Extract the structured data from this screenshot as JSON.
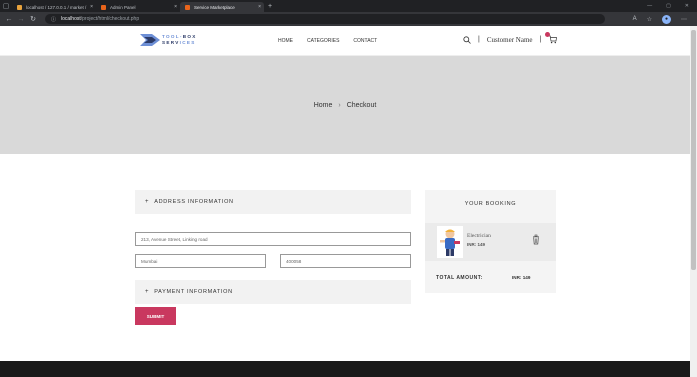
{
  "browser": {
    "tabs": [
      {
        "label": "localhost / 127.0.0.1 / market /",
        "favicon_color": "#e8a33d"
      },
      {
        "label": "Admin Panel",
        "favicon_color": "#e8641b"
      },
      {
        "label": "Service Marketplace",
        "favicon_color": "#e8641b"
      }
    ],
    "address": {
      "host": "localhost",
      "path": "/project/html/checkout.php"
    }
  },
  "header": {
    "logo": {
      "line1_a": "TOOL-",
      "line1_b": "BOX",
      "line2_a": "SERV",
      "line2_b": "ICES"
    },
    "nav": [
      "HOME",
      "CATEGORIES",
      "CONTACT"
    ],
    "user_label": "Customer Name"
  },
  "banner": {
    "crumb_home": "Home",
    "crumb_current": "Checkout"
  },
  "form": {
    "address_heading": "ADDRESS INFORMATION",
    "address_value": "213, Avenue Street, Linking road",
    "city_value": "Mumbai",
    "zip_value": "400058",
    "payment_heading": "PAYMENT INFORMATION",
    "submit_label": "SUBMIT"
  },
  "booking": {
    "title": "YOUR BOOKING",
    "item_name": "Electrician",
    "item_price": "INR: 149",
    "total_label": "TOTAL AMOUNT:",
    "total_value": "INR: 149"
  },
  "colors": {
    "accent": "#c9385f",
    "banner": "#d9d9d9",
    "logo_dark": "#2b3a67",
    "logo_light": "#6d8fd6"
  }
}
